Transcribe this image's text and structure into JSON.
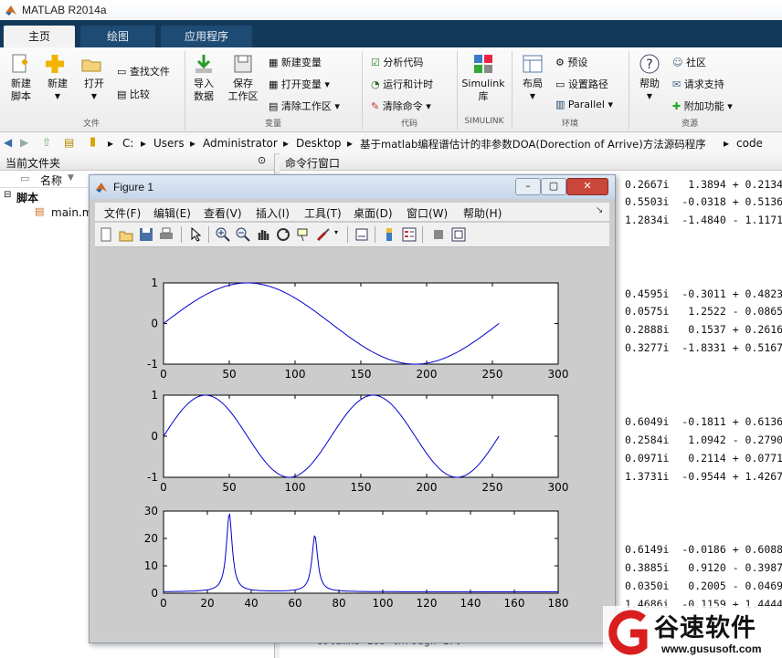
{
  "window": {
    "title": "MATLAB R2014a"
  },
  "tabs": [
    {
      "label": "主页"
    },
    {
      "label": "绘图"
    },
    {
      "label": "应用程序"
    }
  ],
  "ribbon": {
    "file_group": {
      "label": "文件",
      "new_script": "新建\n脚本",
      "new": "新建",
      "open": "打开",
      "find_files": "查找文件",
      "compare": "比较"
    },
    "variable_group": {
      "label": "变量",
      "import": "导入\n数据",
      "save_ws": "保存\n工作区",
      "new_var": "新建变量",
      "open_var": "打开变量",
      "clear_ws": "清除工作区"
    },
    "code_group": {
      "label": "代码",
      "analyze": "分析代码",
      "run_time": "运行和计时",
      "clear_cmd": "清除命令"
    },
    "simulink_group": {
      "label": "SIMULINK",
      "lib": "Simulink\n库"
    },
    "env_group": {
      "label": "环境",
      "layout": "布局",
      "prefs": "预设",
      "set_path": "设置路径",
      "parallel": "Parallel"
    },
    "resources_group": {
      "label": "资源",
      "help": "帮助",
      "community": "社区",
      "support": "请求支持",
      "addons": "附加功能"
    }
  },
  "path": {
    "segments": [
      "C:",
      "Users",
      "Administrator",
      "Desktop",
      "基于matlab编程谱估计的非参数DOA(Dorection of Arrive)方法源码程序",
      "code"
    ]
  },
  "left_panel": {
    "title": "当前文件夹",
    "column": "名称",
    "group": "脚本",
    "file": "main.m"
  },
  "right_panel": {
    "title": "命令行窗口",
    "lines": [
      "0.2667i   1.3894 + 0.2134",
      "0.5503i  -0.0318 + 0.5136",
      "1.2834i  -1.4840 - 1.1171",
      "0.4595i  -0.3011 + 0.4823",
      "0.0575i   1.2522 - 0.0865",
      "0.2888i   0.1537 + 0.2616",
      "0.3277i  -1.8331 + 0.5167",
      "0.6049i  -0.1811 + 0.6136",
      "0.2584i   1.0942 - 0.2790",
      "0.0971i   0.2114 + 0.0771",
      "1.3731i  -0.9544 + 1.4267",
      "0.6149i  -0.0186 + 0.6088",
      "0.3885i   0.9120 - 0.3987",
      "0.0350i   0.2005 - 0.0469",
      "1.4686i  -0.1159 + 1.4444"
    ],
    "bottom_line": "Columns 169 through 170"
  },
  "figure": {
    "title": "Figure 1",
    "menu": [
      "文件(F)",
      "编辑(E)",
      "查看(V)",
      "插入(I)",
      "工具(T)",
      "桌面(D)",
      "窗口(W)",
      "帮助(H)"
    ]
  },
  "watermark": {
    "brand": "谷速软件",
    "url": "www.gususoft.com"
  },
  "colors": {
    "accent": "#13395a",
    "plot_line": "#0000cc"
  },
  "chart_data": [
    {
      "type": "line",
      "x_range": [
        0,
        255
      ],
      "function": "sin(2*pi*t/255)",
      "xlim": [
        0,
        300
      ],
      "ylim": [
        -1,
        1
      ],
      "xticks": [
        0,
        50,
        100,
        150,
        200,
        250,
        300
      ],
      "yticks": [
        -1,
        0,
        1
      ]
    },
    {
      "type": "line",
      "x_range": [
        0,
        255
      ],
      "function": "sin(2*pi*t/127.5)",
      "xlim": [
        0,
        300
      ],
      "ylim": [
        -1,
        1
      ],
      "xticks": [
        0,
        50,
        100,
        150,
        200,
        250,
        300
      ],
      "yticks": [
        -1,
        0,
        1
      ]
    },
    {
      "type": "line",
      "peaks": [
        {
          "x": 30,
          "y": 29
        },
        {
          "x": 69,
          "y": 21
        }
      ],
      "baseline": 0.5,
      "x_range": [
        0,
        180
      ],
      "xlim": [
        0,
        180
      ],
      "ylim": [
        0,
        30
      ],
      "xticks": [
        0,
        20,
        40,
        60,
        80,
        100,
        120,
        140,
        160,
        180
      ],
      "yticks": [
        0,
        10,
        20,
        30
      ]
    }
  ]
}
